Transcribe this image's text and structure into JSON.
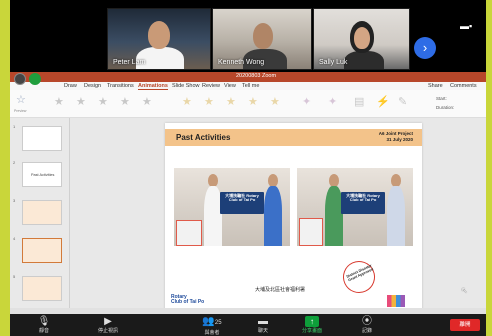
{
  "video": {
    "participants": [
      {
        "name": "Peter Lam"
      },
      {
        "name": "Kenneth Wong"
      },
      {
        "name": "Sally Luk"
      }
    ],
    "next_icon": "chevron-right-icon"
  },
  "ppt": {
    "window_title": "20200803 Zoom",
    "tabs": [
      "Draw",
      "Design",
      "Transitions",
      "Animations",
      "Slide Show",
      "Review",
      "View",
      "Tell me"
    ],
    "active_tab": "Animations",
    "share_label": "Share",
    "comments_label": "Comments",
    "start_label": "Start:",
    "duration_label": "Duration:",
    "preview_label": "Preview",
    "thumbnails": [
      {
        "num": "1"
      },
      {
        "num": "2",
        "title": "Past Activities"
      },
      {
        "num": "3"
      },
      {
        "num": "4"
      },
      {
        "num": "5"
      }
    ]
  },
  "slide": {
    "title": "Past Activities",
    "project_line1": "A6 Joint Project",
    "project_line2": "31 July 2020",
    "caption": "大埔及北區社會福利署",
    "stamp_text": "District Disaster Grant Approved",
    "banner_text": "大埔扶輪社 Rotary Club of Tai Po",
    "logo_line1": "Rotary",
    "logo_line2": "Club of Tai Po"
  },
  "toolbar": {
    "mute_label": "靜音",
    "video_label": "停止視訊",
    "participants_label": "與會者",
    "participants_count": "25",
    "chat_label": "聊天",
    "share_label": "分享畫面",
    "record_label": "記錄",
    "leave_label": "離開"
  },
  "colors": {
    "ppt_accent": "#b7472a",
    "slide_header": "#f3c38a",
    "zoom_blue": "#2e6ce6",
    "leave_red": "#e02828"
  }
}
